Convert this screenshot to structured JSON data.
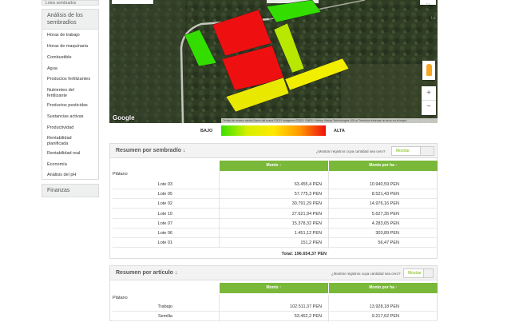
{
  "sidebar": {
    "top_partial": "Lotes sembrados",
    "section_title": "Análisis de los sembradíos",
    "items": [
      {
        "label": "Horas de trabajo"
      },
      {
        "label": "Horas de maquinaria"
      },
      {
        "label": "Combustible"
      },
      {
        "label": "Agua"
      },
      {
        "label": "Productos fertilizantes"
      },
      {
        "label": "Nutrientes del fertilizante"
      },
      {
        "label": "Productos pesticidas"
      },
      {
        "label": "Sustancias activas"
      },
      {
        "label": "Productividad"
      },
      {
        "label": "Rentabilidad planificada"
      },
      {
        "label": "Rentabilidad real"
      },
      {
        "label": "Economía"
      },
      {
        "label": "Análisis del pH"
      }
    ],
    "finance": "Finanzas"
  },
  "map": {
    "google": "Google",
    "attribution": "Teclas de acceso rápido   Datos del mapa ©2021 Imágenes ©2021 CNES / Airbus, Maxar Technologies   100 m   Términos   Informar un error en el mapa",
    "right_label": "La",
    "zoom_in": "+",
    "zoom_out": "−",
    "colors": {
      "red": "#ee1010",
      "yellow": "#f2ee00",
      "green": "#33dd00",
      "lime": "#b8e800"
    }
  },
  "legend": {
    "low": "BAJO",
    "high": "ALTA"
  },
  "panel1": {
    "title": "Resumen por sembradío",
    "sort_icon": "↓",
    "question": "¿Mostrar registros cuya cantidad sea cero?",
    "button": "Mostrar",
    "col1": "Monto ↑",
    "col2": "Monto por ha ↑",
    "group": "Plátano",
    "rows": [
      {
        "name": "Lote 03",
        "monto": "63.455,4 PEN",
        "ha": "10.940,59 PEN"
      },
      {
        "name": "Lote 05",
        "monto": "57.775,3 PEN",
        "ha": "8.521,43 PEN"
      },
      {
        "name": "Lote 02",
        "monto": "30.791,29 PEN",
        "ha": "14.976,16 PEN"
      },
      {
        "name": "Lote 10",
        "monto": "27.621,94 PEN",
        "ha": "5.627,35 PEN"
      },
      {
        "name": "Lote 07",
        "monto": "15.378,32 PEN",
        "ha": "4.283,65 PEN"
      },
      {
        "name": "Lote 06",
        "monto": "1.451,12 PEN",
        "ha": "303,89 PEN"
      },
      {
        "name": "Lote 01",
        "monto": "151,2 PEN",
        "ha": "56,47 PEN"
      }
    ],
    "total": "Total: 196.654,37 PEN"
  },
  "panel2": {
    "title": "Resumen por artículo",
    "sort_icon": "↓",
    "question": "¿Mostrar registros cuya cantidad sea cero?",
    "button": "Mostrar",
    "col1": "Monto ↑",
    "col2": "Monto por ha ↑",
    "group": "Plátano",
    "rows": [
      {
        "name": "Trabajo",
        "monto": "102.511,37 PEN",
        "ha": "13.928,18 PEN"
      },
      {
        "name": "Semilla",
        "monto": "53.462,2 PEN",
        "ha": "9.217,62 PEN"
      }
    ]
  }
}
